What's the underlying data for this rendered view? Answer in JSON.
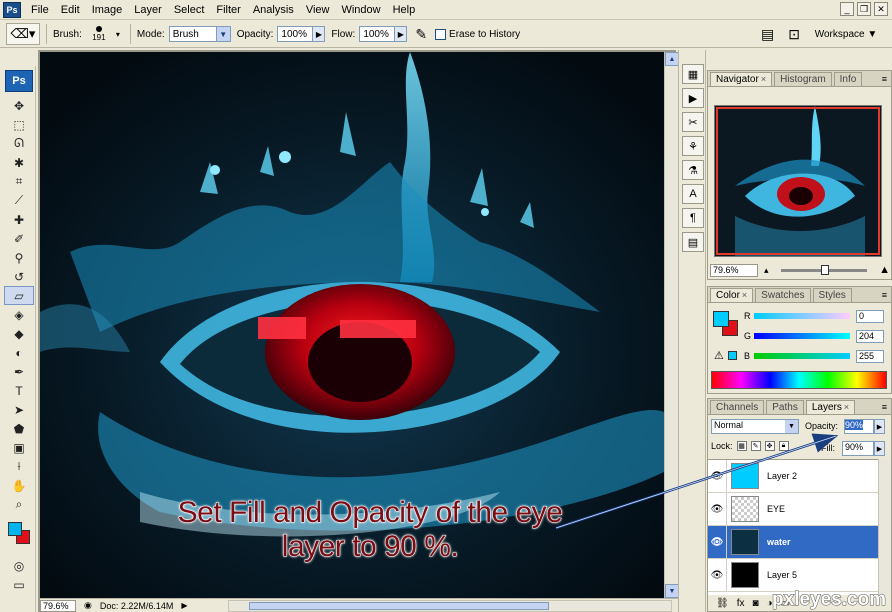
{
  "menubar": {
    "app_icon": "Ps",
    "items": [
      "File",
      "Edit",
      "Image",
      "Layer",
      "Select",
      "Filter",
      "Analysis",
      "View",
      "Window",
      "Help"
    ]
  },
  "optbar": {
    "brush_label": "Brush:",
    "brush_size": "191",
    "mode_label": "Mode:",
    "mode_value": "Brush",
    "opacity_label": "Opacity:",
    "opacity_value": "100%",
    "flow_label": "Flow:",
    "flow_value": "100%",
    "erase_history_label": "Erase to History",
    "erase_history_checked": false,
    "workspace_label": "Workspace"
  },
  "toolbox": {
    "badge": "Ps",
    "foreground_color": "#00b4f0",
    "background_color": "#e0101a"
  },
  "caption": {
    "line1": "Set Fill and Opacity of the eye",
    "line2": "layer to 90 %."
  },
  "status": {
    "zoom": "79.6%",
    "doc": "Doc: 2.22M/6.14M"
  },
  "navigator": {
    "tabs": [
      "Navigator",
      "Histogram",
      "Info"
    ],
    "active_tab": "Navigator",
    "zoom": "79.6%"
  },
  "color_panel": {
    "tabs": [
      "Color",
      "Swatches",
      "Styles"
    ],
    "active_tab": "Color",
    "r_label": "R",
    "g_label": "G",
    "b_label": "B",
    "r": "0",
    "g": "204",
    "b": "255"
  },
  "layers_panel": {
    "tabs": [
      "Channels",
      "Paths",
      "Layers"
    ],
    "active_tab": "Layers",
    "blend_mode": "Normal",
    "opacity_label": "Opacity:",
    "opacity": "90%",
    "lock_label": "Lock:",
    "fill_label": "Fill:",
    "fill": "90%",
    "layers": [
      {
        "name": "Layer 2",
        "selected": false
      },
      {
        "name": "EYE",
        "selected": false
      },
      {
        "name": "water",
        "selected": true
      },
      {
        "name": "Layer 5",
        "selected": false
      }
    ]
  },
  "watermark": "pxleyes.com"
}
